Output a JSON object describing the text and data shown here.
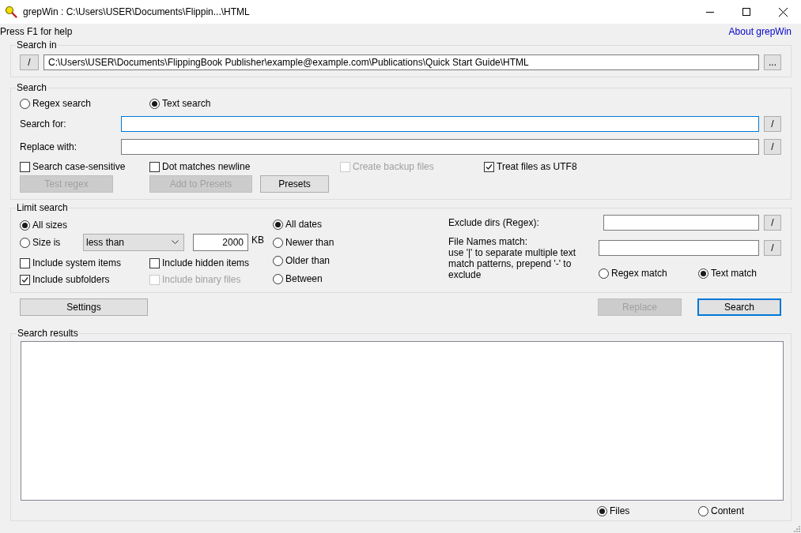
{
  "window": {
    "title": "grepWin : C:\\Users\\USER\\Documents\\Flippin...\\HTML"
  },
  "help_text": "Press F1 for help",
  "about_link": "About grepWin",
  "search_in": {
    "title": "Search in",
    "folder_button": "/",
    "path": "C:\\Users\\USER\\Documents\\FlippingBook Publisher\\example@example.com\\Publications\\Quick Start Guide\\HTML",
    "browse_button": "..."
  },
  "search": {
    "title": "Search",
    "modes": [
      {
        "label": "Regex search",
        "selected": false
      },
      {
        "label": "Text search",
        "selected": true
      }
    ],
    "fields": [
      {
        "label": "Search for:",
        "focused": true,
        "button": "/"
      },
      {
        "label": "Replace with:",
        "focused": false,
        "button": "/"
      }
    ],
    "options": [
      {
        "label": "Search case-sensitive",
        "checked": false,
        "disabled": false
      },
      {
        "label": "Dot matches newline",
        "checked": false,
        "disabled": false
      },
      {
        "label": "Create backup files",
        "checked": false,
        "disabled": true
      },
      {
        "label": "Treat files as UTF8",
        "checked": true,
        "disabled": false
      }
    ],
    "buttons": [
      {
        "label": "Test regex",
        "disabled": true
      },
      {
        "label": "Add to Presets",
        "disabled": true
      },
      {
        "label": "Presets",
        "disabled": false
      }
    ]
  },
  "limit_search": {
    "title": "Limit search",
    "size_modes": [
      {
        "label": "All sizes",
        "selected": true
      },
      {
        "label": "Size is",
        "selected": false
      }
    ],
    "size_comparison": "less than",
    "size_value": "2000",
    "size_unit": "KB",
    "options": [
      {
        "label": "Include system items",
        "checked": false,
        "disabled": false
      },
      {
        "label": "Include hidden items",
        "checked": false,
        "disabled": false
      },
      {
        "label": "Include subfolders",
        "checked": true,
        "disabled": false
      },
      {
        "label": "Include binary files",
        "checked": false,
        "disabled": true
      }
    ],
    "date_modes": [
      {
        "label": "All dates",
        "selected": true
      },
      {
        "label": "Newer than",
        "selected": false
      },
      {
        "label": "Older than",
        "selected": false
      },
      {
        "label": "Between",
        "selected": false
      }
    ],
    "exclude_dirs": {
      "label": "Exclude dirs (Regex):",
      "button": "/"
    },
    "file_names": {
      "label": "File Names match:\nuse '|' to separate multiple text match patterns, prepend '-' to exclude",
      "button": "/"
    },
    "match_modes": [
      {
        "label": "Regex match",
        "selected": false
      },
      {
        "label": "Text match",
        "selected": true
      }
    ]
  },
  "actions": [
    {
      "label": "Settings",
      "disabled": false,
      "default": false
    },
    {
      "label": "Replace",
      "disabled": true,
      "default": false
    },
    {
      "label": "Search",
      "disabled": false,
      "default": true
    }
  ],
  "search_results": {
    "title": "Search results",
    "result_types": [
      {
        "label": "Files",
        "selected": true
      },
      {
        "label": "Content",
        "selected": false
      }
    ]
  }
}
